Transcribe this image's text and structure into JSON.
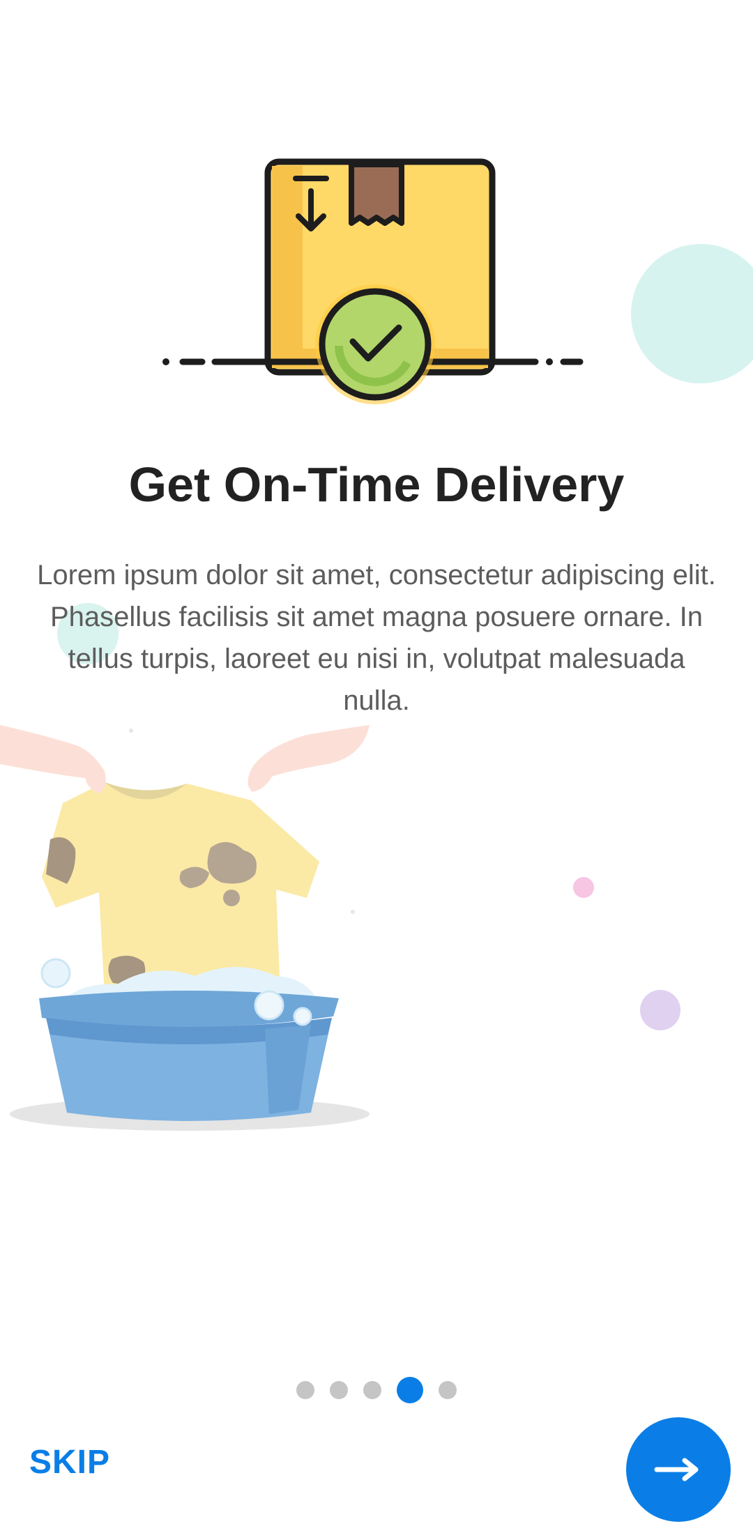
{
  "onboarding": {
    "title": "Get On-Time Delivery",
    "description": "Lorem ipsum dolor sit amet, consectetur adipiscing elit. Phasellus facilisis sit amet magna posuere ornare. In tellus turpis, laoreet eu nisi in, volutpat malesuada nulla.",
    "hero_icon": "delivered-box-icon",
    "illustration": "laundry-illustration"
  },
  "pager": {
    "total": 5,
    "current": 4
  },
  "footer": {
    "skip_label": "SKIP",
    "next_icon": "arrow-right-icon"
  },
  "colors": {
    "accent": "#0a7ee6",
    "title": "#222222",
    "body_text": "#5c5c5c",
    "dot_inactive": "#c5c5c5"
  }
}
